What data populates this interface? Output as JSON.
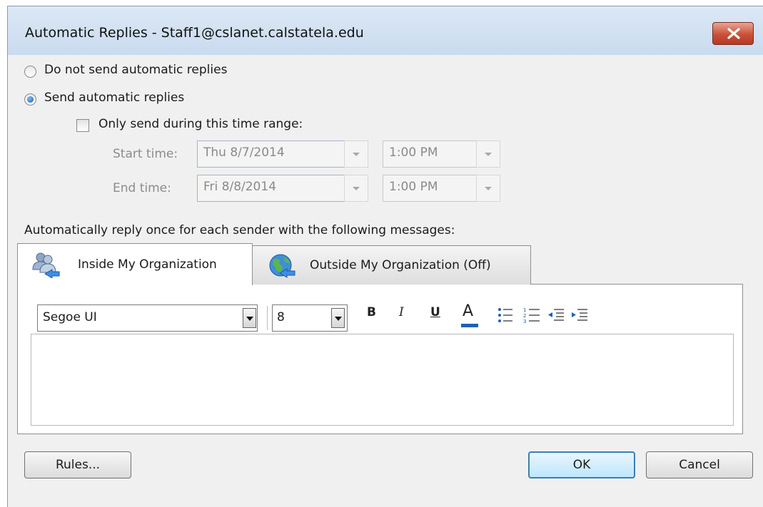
{
  "window": {
    "title": "Automatic Replies - Staff1@cslanet.calstatela.edu"
  },
  "colors": {
    "titlebar": "#c9dbef",
    "close": "#c9503a",
    "accent": "#3c7fb1"
  },
  "options": {
    "do_not_send": {
      "label": "Do not send automatic replies",
      "selected": false
    },
    "send": {
      "label": "Send automatic replies",
      "selected": true
    }
  },
  "time_range": {
    "checkbox_label": "Only send during this time range:",
    "checked": false,
    "start_label": "Start time:",
    "start_date": "Thu 8/7/2014",
    "start_time": "1:00 PM",
    "end_label": "End time:",
    "end_date": "Fri 8/8/2014",
    "end_time": "1:00 PM"
  },
  "reply_heading": "Automatically reply once for each sender with the following messages:",
  "tabs": [
    {
      "label": "Inside My Organization",
      "icon": "people-icon",
      "active": true
    },
    {
      "label": "Outside My Organization (Off)",
      "icon": "globe-icon",
      "active": false
    }
  ],
  "toolbar": {
    "font": "Segoe UI",
    "size": "8",
    "bold": "B",
    "italic": "I",
    "underline": "U",
    "font_color": "A",
    "font_color_value": "#1f5fb4"
  },
  "editor": {
    "value": ""
  },
  "buttons": {
    "rules": "Rules...",
    "ok": "OK",
    "cancel": "Cancel"
  }
}
